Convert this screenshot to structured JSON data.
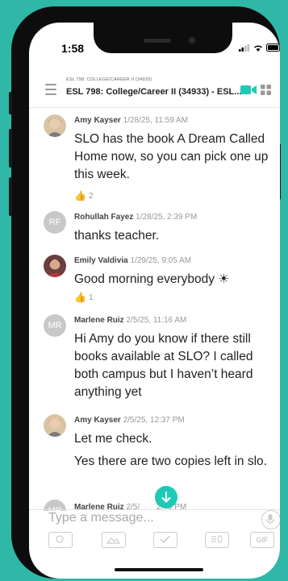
{
  "status": {
    "time": "1:58"
  },
  "header": {
    "course_small": "ESL 798: COLLEGE/CAREER II (34933)",
    "course_title": "ESL 798: College/Career II (34933) - ESL..."
  },
  "messages": [
    {
      "author": "Amy Kayser",
      "time": "1/28/25, 11:59 AM",
      "text": "SLO has the book A Dream Called Home now, so you can pick one up this week.",
      "reaction_count": "2"
    },
    {
      "author": "Rohullah Fayez",
      "initials": "RF",
      "time": "1/28/25, 2:39 PM",
      "text": "thanks teacher."
    },
    {
      "author": "Emily Valdivia",
      "time": "1/29/25, 9:05 AM",
      "text": "Good morning everybody ☀",
      "reaction_count": "1"
    },
    {
      "author": "Marlene Ruiz",
      "initials": "MR",
      "time": "2/5/25, 11:16 AM",
      "text": "Hi Amy do you know if there still books available at SLO? I called both campus but I haven’t heard anything yet"
    },
    {
      "author": "Amy Kayser",
      "time": "2/5/25, 12:37 PM",
      "text": "Let me check.",
      "text2": "Yes there are two copies left in slo."
    },
    {
      "author": "Marlene Ruiz",
      "initials": "MR",
      "time_partial": "2/5/",
      "time_tail": "2:40 PM"
    }
  ],
  "composer": {
    "placeholder": "Type a message..."
  },
  "toolbar": {
    "gif_label": "GIF"
  },
  "colors": {
    "accent": "#1ec9b5",
    "background": "#2fb8a8"
  }
}
